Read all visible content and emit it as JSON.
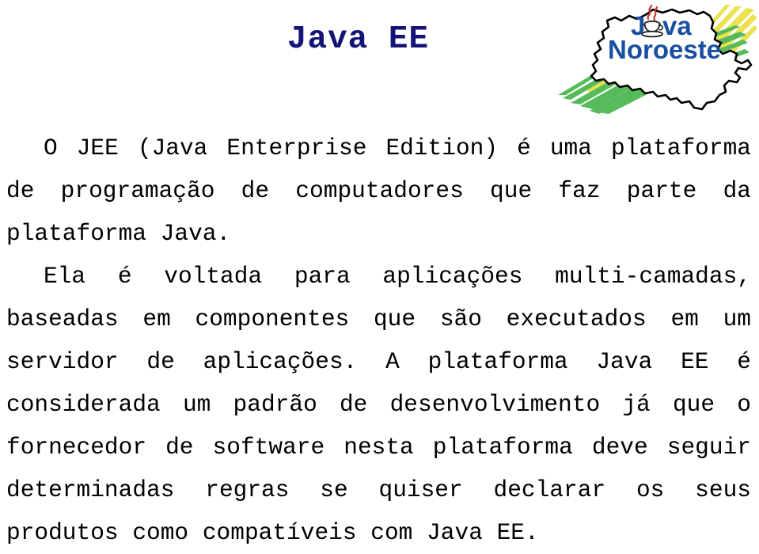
{
  "slide": {
    "title": "Java EE",
    "title_color": "#141478",
    "background_color": "#ffffff",
    "text_color": "#000000"
  },
  "logo": {
    "brand_line1": "J",
    "brand_line1_tail": "va",
    "brand_line2": "Noroeste",
    "brand_color": "#1a4fa0",
    "map_outline_color": "#000000",
    "map_fill_color": "#ffffff",
    "stroke_green": "#57bb5c",
    "stroke_yellow": "#ebe24d",
    "star_color": "#f5c518",
    "cup_steam_color": "#c8332a",
    "cup_body_color": "#ffffff",
    "cup_outline_color": "#1a1a1a"
  },
  "content": {
    "paragraphs": [
      "O JEE (Java Enterprise Edition) é uma plataforma de programação de computadores que faz parte da plataforma Java.",
      "Ela é voltada para aplicações multi-camadas, baseadas em componentes que são executados em um servidor de aplicações. A plataforma Java EE é considerada um padrão de desenvolvimento já que o fornecedor de software nesta plataforma deve seguir determinadas regras se quiser declarar os seus produtos como compatíveis com Java EE."
    ]
  }
}
